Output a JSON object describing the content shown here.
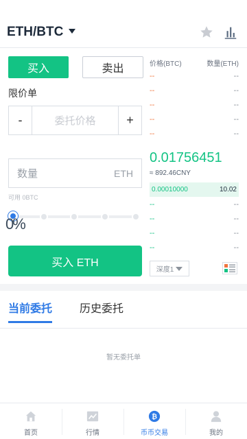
{
  "header": {
    "pair": "ETH/BTC"
  },
  "trade": {
    "buy_tab": "买入",
    "sell_tab": "卖出",
    "order_type": "限价单",
    "minus": "-",
    "plus": "+",
    "price_placeholder": "委托价格",
    "qty_placeholder": "数量",
    "qty_unit": "ETH",
    "available": "可用 0BTC",
    "percent": "0%",
    "slider_value": 0,
    "buy_button": "买入 ETH"
  },
  "orderbook": {
    "price_header": "价格(BTC)",
    "qty_header": "数量(ETH)",
    "asks": [
      {
        "price": "--",
        "qty": "--"
      },
      {
        "price": "--",
        "qty": "--"
      },
      {
        "price": "--",
        "qty": "--"
      },
      {
        "price": "--",
        "qty": "--"
      },
      {
        "price": "--",
        "qty": "--"
      }
    ],
    "last_price": "0.01756451",
    "last_price_cny": "≈ 892.46CNY",
    "bids": [
      {
        "price": "0.00010000",
        "qty": "10.02"
      },
      {
        "price": "--",
        "qty": "--"
      },
      {
        "price": "--",
        "qty": "--"
      },
      {
        "price": "--",
        "qty": "--"
      },
      {
        "price": "--",
        "qty": "--"
      }
    ],
    "depth_label": "深度1"
  },
  "orders": {
    "tab_current": "当前委托",
    "tab_history": "历史委托",
    "empty": "暂无委托单"
  },
  "nav": {
    "items": [
      {
        "label": "首页",
        "icon": "home-icon"
      },
      {
        "label": "行情",
        "icon": "market-icon"
      },
      {
        "label": "币币交易",
        "icon": "exchange-icon"
      },
      {
        "label": "我的",
        "icon": "profile-icon"
      }
    ],
    "active_index": 2
  },
  "colors": {
    "buy_green": "#13c384",
    "ask_orange": "#f0743e",
    "accent_blue": "#2f7ae5"
  }
}
